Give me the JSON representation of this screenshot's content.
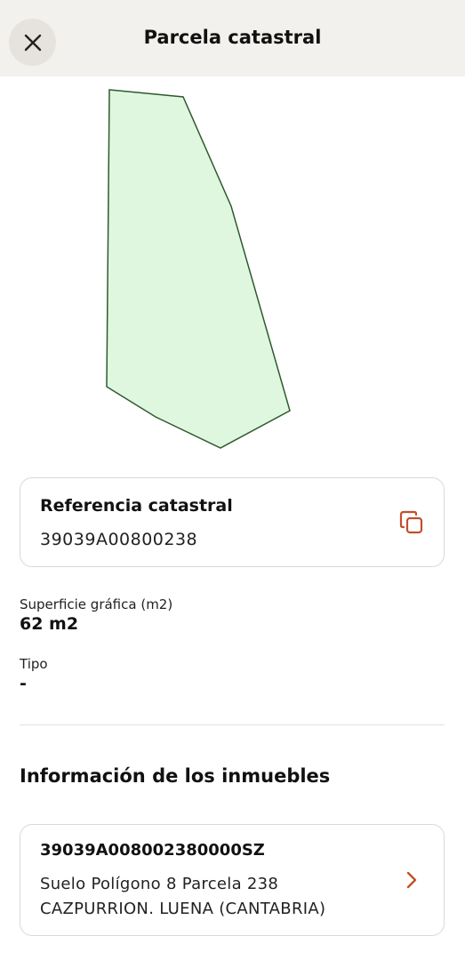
{
  "header": {
    "title": "Parcela catastral",
    "close_icon": "close-icon"
  },
  "parcel_map": {
    "fill_color": "#dff7df",
    "stroke_color": "#2f5a2f"
  },
  "reference": {
    "label": "Referencia catastral",
    "value": "39039A00800238",
    "copy_icon": "copy-icon",
    "accent_color": "#c0502a"
  },
  "details": [
    {
      "label": "Superficie gráfica (m2)",
      "value": "62 m2"
    },
    {
      "label": "Tipo",
      "value": "-"
    }
  ],
  "properties_section": {
    "title": "Información de los inmuebles",
    "items": [
      {
        "reference": "39039A008002380000SZ",
        "line1": "Suelo Polígono 8 Parcela 238",
        "line2": "CAZPURRION. LUENA (CANTABRIA)",
        "chevron_icon": "chevron-right-icon"
      }
    ]
  }
}
